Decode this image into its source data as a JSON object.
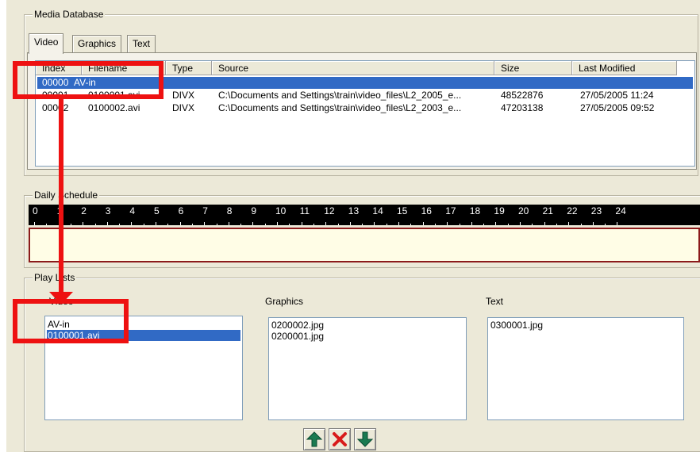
{
  "media_database": {
    "title": "Media Database",
    "tabs": [
      {
        "label": "Video",
        "active": true
      },
      {
        "label": "Graphics",
        "active": false
      },
      {
        "label": "Text",
        "active": false
      }
    ],
    "columns": [
      "Index",
      "Filename",
      "Type",
      "Source",
      "Size",
      "Last Modified"
    ],
    "rows": [
      {
        "index": "00000",
        "filename": "AV-in",
        "type": "",
        "source": "",
        "size": "",
        "modified": "",
        "selected": true
      },
      {
        "index": "00001",
        "filename": "0100001.avi",
        "type": "DIVX",
        "source": "C:\\Documents and Settings\\train\\video_files\\L2_2005_e...",
        "size": "48522876",
        "modified": "27/05/2005 11:24",
        "selected": false
      },
      {
        "index": "00002",
        "filename": "0100002.avi",
        "type": "DIVX",
        "source": "C:\\Documents and Settings\\train\\video_files\\L2_2003_e...",
        "size": "47203138",
        "modified": "27/05/2005 09:52",
        "selected": false
      }
    ]
  },
  "daily_schedule": {
    "title": "Daily Schedule",
    "hours": [
      "0",
      "1",
      "2",
      "3",
      "4",
      "5",
      "6",
      "7",
      "8",
      "9",
      "10",
      "11",
      "12",
      "13",
      "14",
      "15",
      "16",
      "17",
      "18",
      "19",
      "20",
      "21",
      "22",
      "23",
      "24"
    ]
  },
  "play_lists": {
    "title": "Play Lists",
    "video": {
      "label": "Video",
      "items": [
        {
          "text": "AV-in",
          "selected": false
        },
        {
          "text": "0100001.avi",
          "selected": true
        }
      ]
    },
    "graphics": {
      "label": "Graphics",
      "items": [
        {
          "text": "0200002.jpg",
          "selected": false
        },
        {
          "text": "0200001.jpg",
          "selected": false
        }
      ]
    },
    "text": {
      "label": "Text",
      "items": [
        {
          "text": "0300001.jpg",
          "selected": false
        }
      ]
    }
  },
  "toolbar": {
    "buttons": [
      {
        "name": "move-up-button",
        "icon": "arrow-up-icon",
        "color": "#1a7a50"
      },
      {
        "name": "delete-button",
        "icon": "red-x-icon",
        "color": "#d81b1b"
      },
      {
        "name": "move-down-button",
        "icon": "arrow-down-icon",
        "color": "#1a7a50"
      }
    ]
  },
  "colors": {
    "selection": "#316ac5",
    "annotation": "#ee1111",
    "timeline": "#000000",
    "schedule_fill": "#fffde6"
  }
}
